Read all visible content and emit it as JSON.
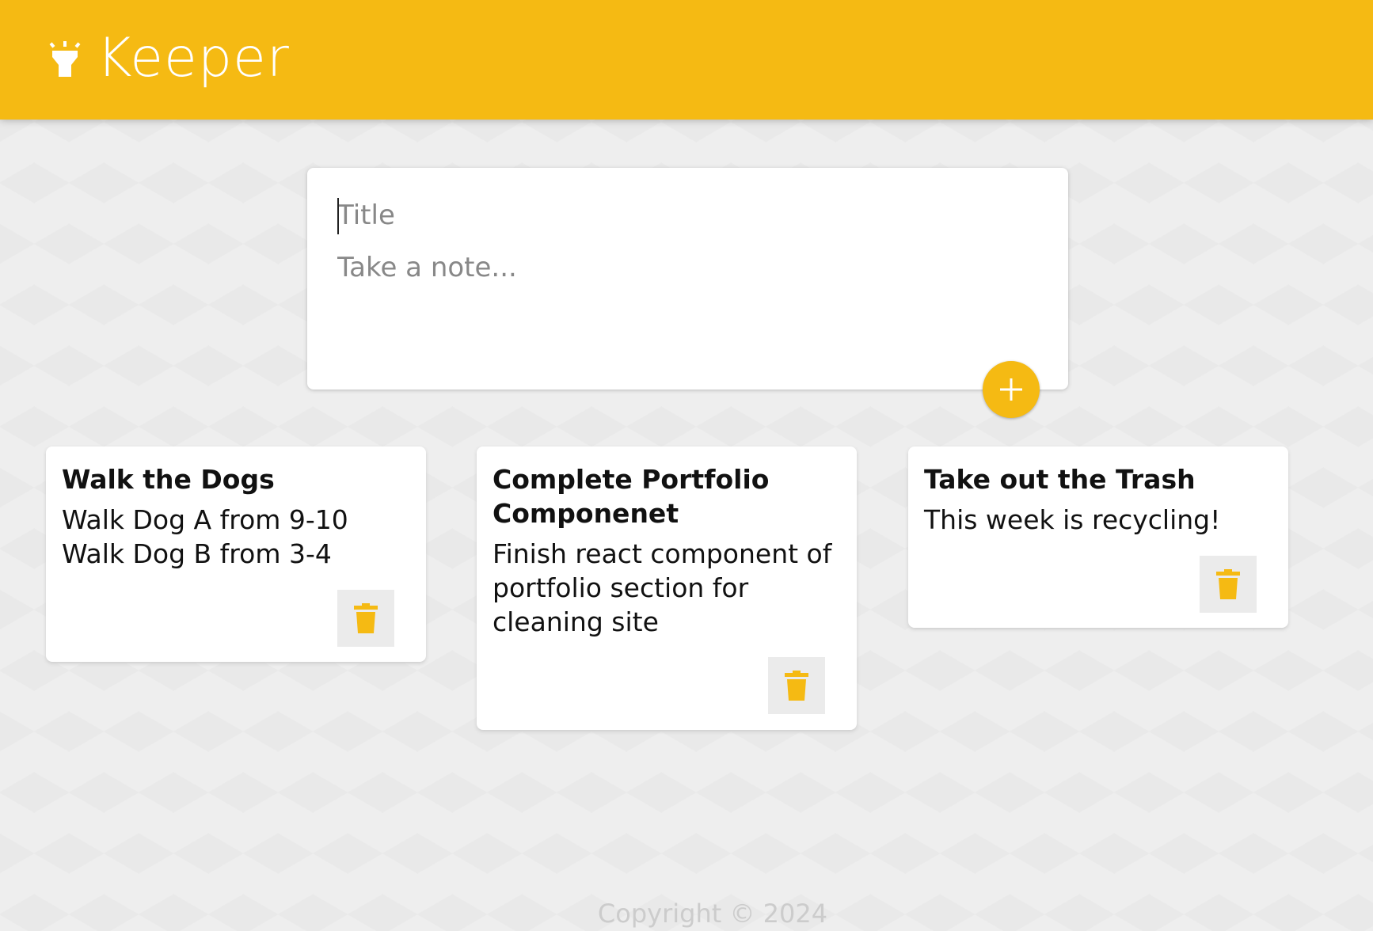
{
  "header": {
    "app_title": "Keeper",
    "logo_icon": "highlight-icon",
    "background_color": "#f5ba13"
  },
  "create_note": {
    "title_placeholder": "Title",
    "title_value": "",
    "content_placeholder": "Take a note...",
    "content_value": "",
    "add_button_icon": "plus-icon",
    "accent_color": "#f5ba13"
  },
  "notes": [
    {
      "title": "Walk the Dogs",
      "content": "Walk Dog A from 9-10\nWalk Dog B from 3-4",
      "delete_icon": "trash-icon"
    },
    {
      "title": "Complete Portfolio Componenet",
      "content": "Finish react component of portfolio section for cleaning site",
      "delete_icon": "trash-icon"
    },
    {
      "title": "Take out the Trash",
      "content": "This week is recycling!",
      "delete_icon": "trash-icon"
    }
  ],
  "footer": {
    "copyright": "Copyright © 2024"
  }
}
